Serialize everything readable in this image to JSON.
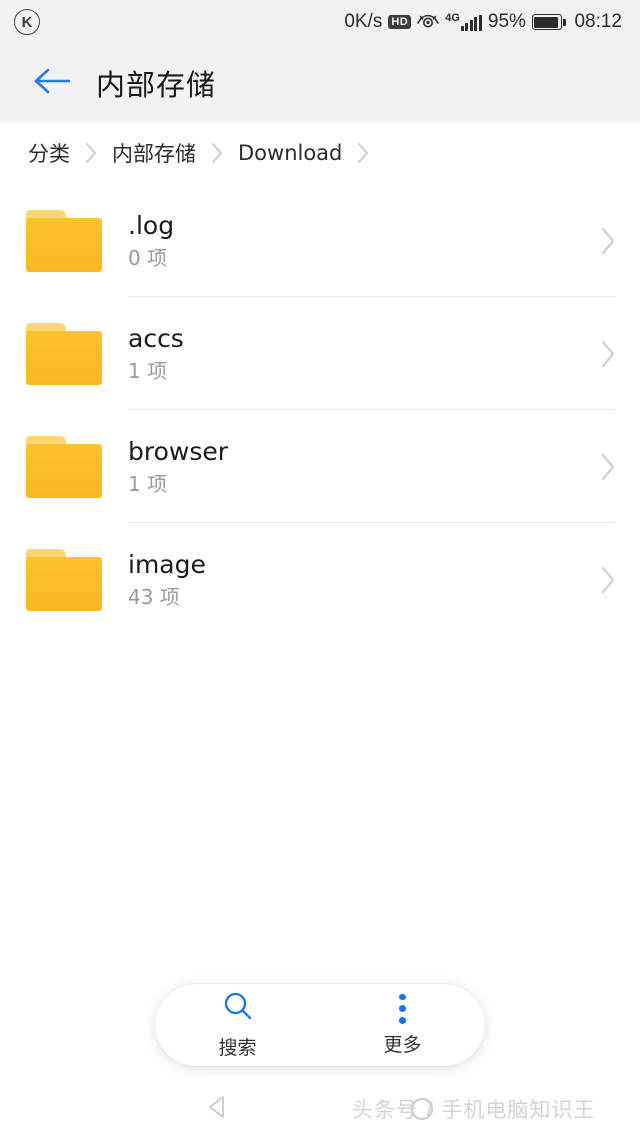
{
  "status_bar": {
    "app_badge": "K",
    "network_speed": "0K/s",
    "hd_badge": "HD",
    "eye_icon": "eye-care-icon",
    "network_type": "4G",
    "signal_bars": 5,
    "battery_percent": "95%",
    "battery_level": 95,
    "clock": "08:12"
  },
  "header": {
    "back_icon": "arrow-left-icon",
    "title": "内部存储"
  },
  "breadcrumb": {
    "separator_icon": "chevron-right-icon",
    "items": [
      {
        "label": "分类"
      },
      {
        "label": "内部存储"
      },
      {
        "label": "Download"
      }
    ],
    "trailing_separator": true
  },
  "file_list": {
    "chevron_icon": "chevron-right-icon",
    "folder_icon": "folder-icon",
    "items": [
      {
        "name": ".log",
        "count": "0 项"
      },
      {
        "name": "accs",
        "count": "1 项"
      },
      {
        "name": "browser",
        "count": "1 项"
      },
      {
        "name": "image",
        "count": "43 项"
      }
    ]
  },
  "toolbar": {
    "search": {
      "label": "搜索",
      "icon": "search-icon"
    },
    "more": {
      "label": "更多",
      "icon": "more-vertical-icon"
    }
  },
  "nav_bar": {
    "back": "triangle-back-icon",
    "home": "circle-home-icon"
  },
  "watermark": {
    "text": "头条号 / 手机电脑知识王"
  },
  "colors": {
    "accent": "#1a73e8",
    "folder": "#fbbe2b",
    "folder_tab": "#fcd672",
    "header_bg": "#f2f2f2",
    "divider": "#e6e6e6",
    "subtext": "#9a9a9a"
  }
}
